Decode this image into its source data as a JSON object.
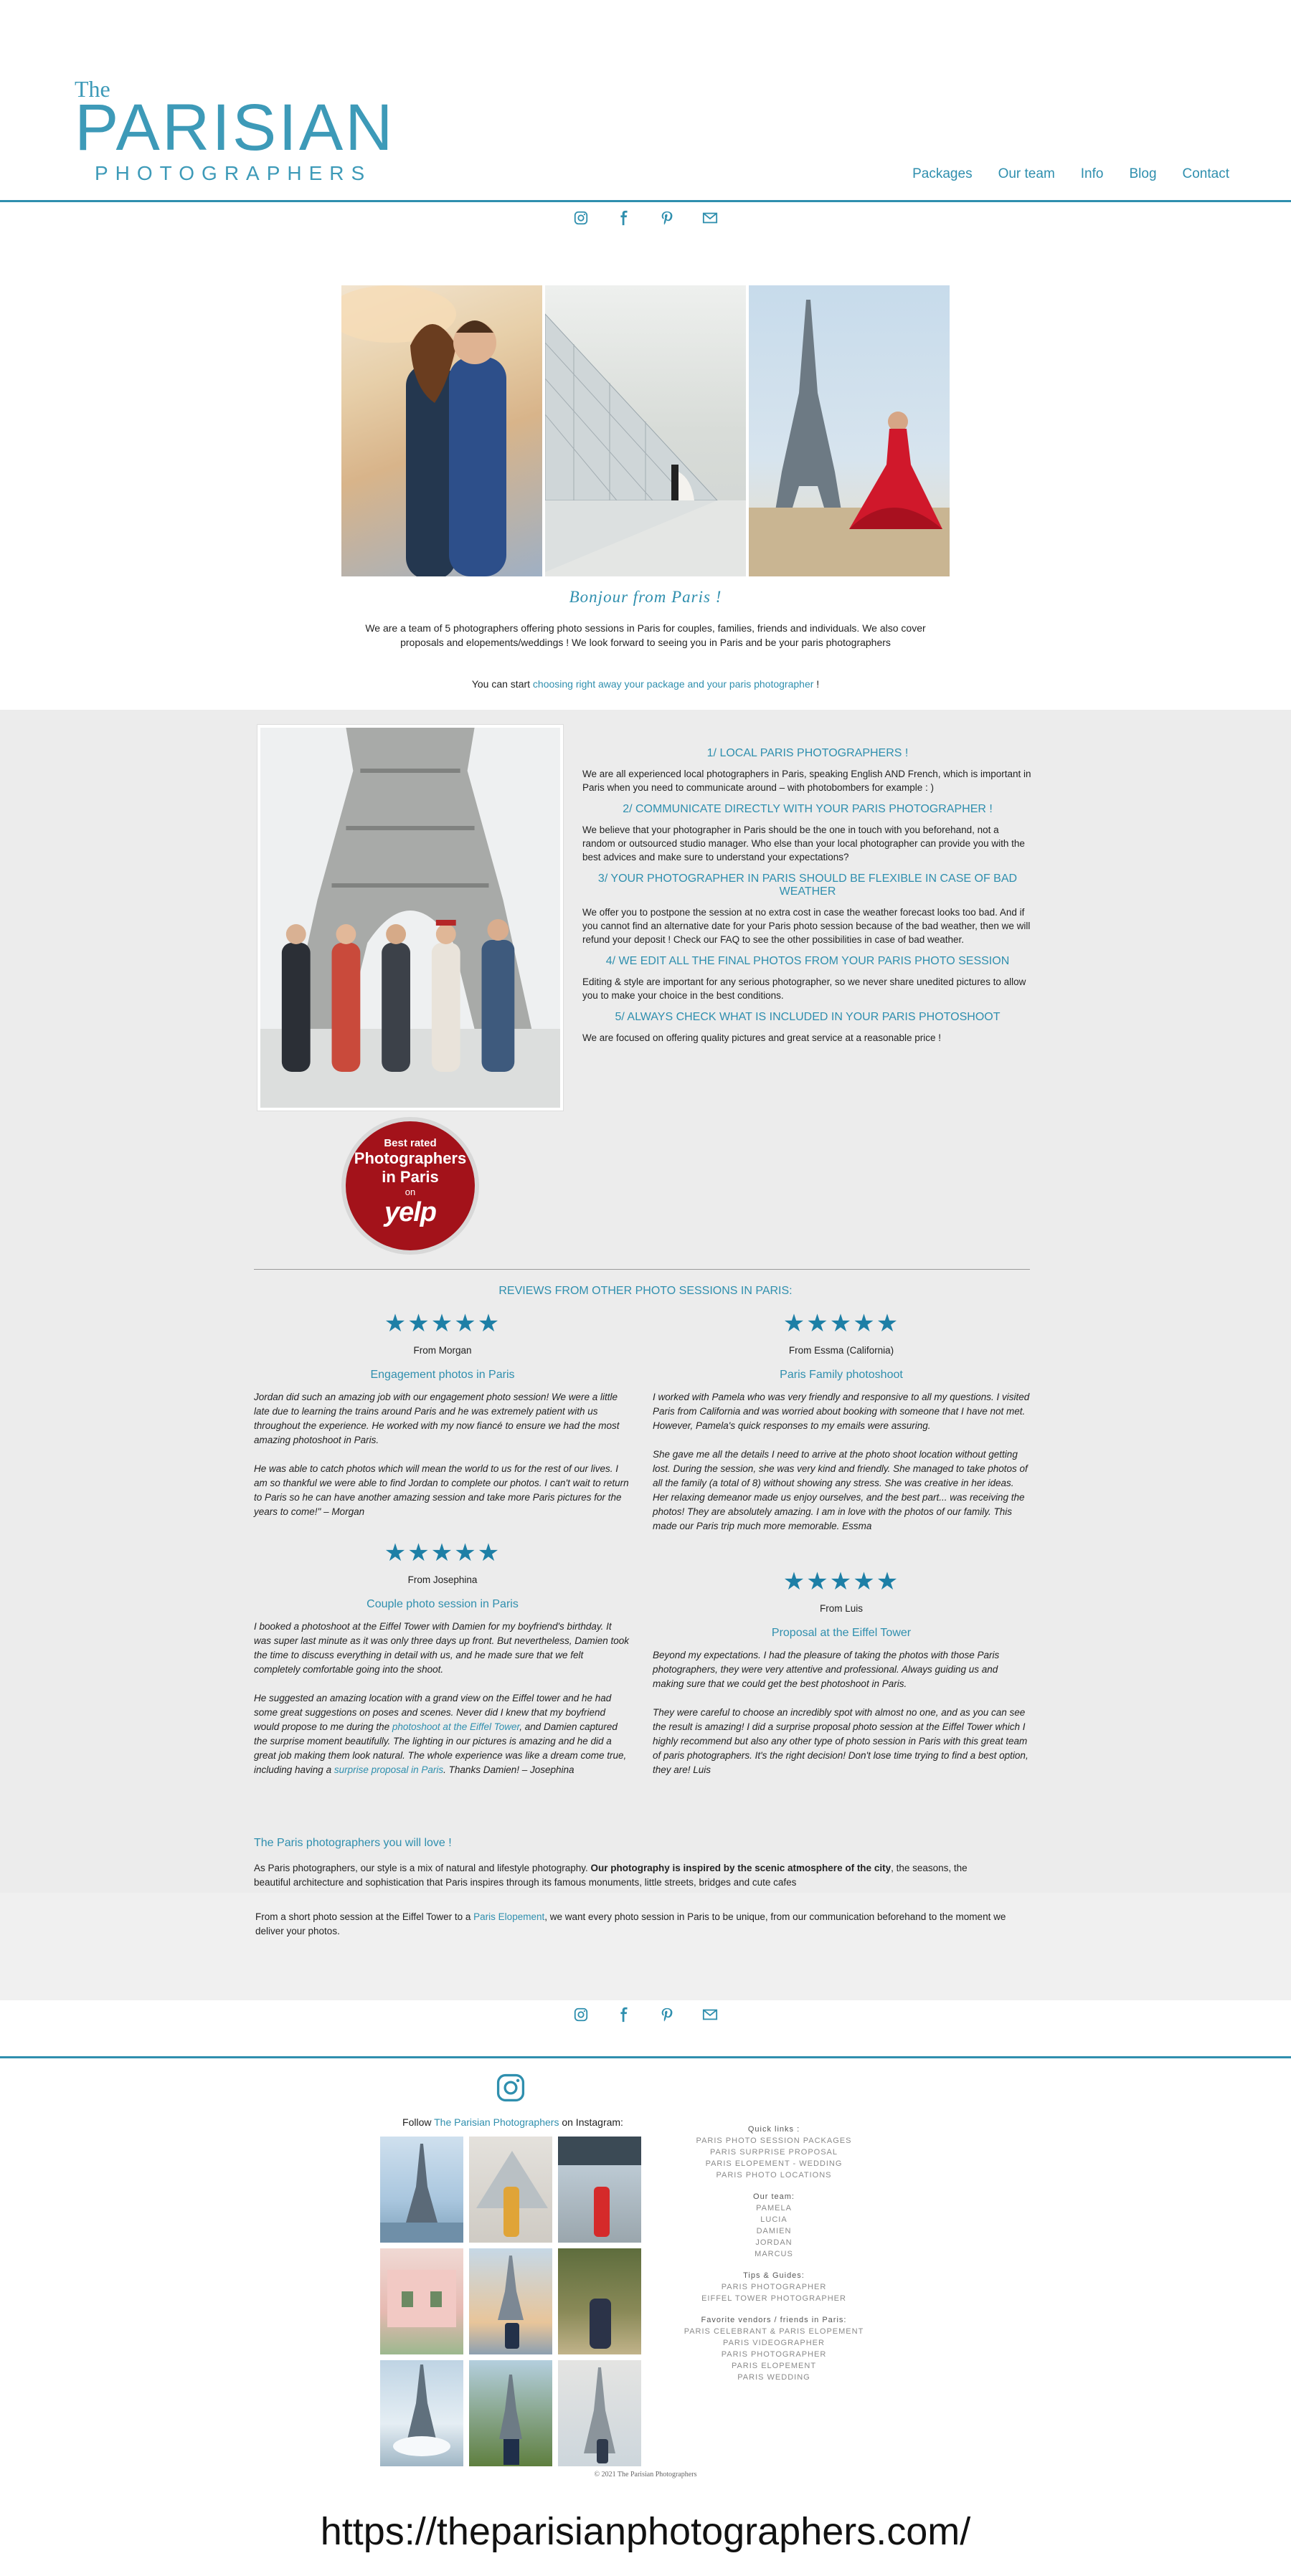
{
  "logo": {
    "line1": "The",
    "line2": "PARISIAN",
    "line3": "PHOTOGRAPHERS"
  },
  "nav": [
    "Packages",
    "Our team",
    "Info",
    "Blog",
    "Contact"
  ],
  "social_icons": [
    "instagram-icon",
    "facebook-icon",
    "pinterest-icon",
    "email-icon"
  ],
  "hero": {
    "title": "Bonjour  from  Paris !",
    "text": "We are a team of 5 photographers offering photo sessions in Paris for couples, families, friends and individuals. We also cover proposals and elopements/weddings ! We look forward to seeing you in Paris and be your paris photographers",
    "start_prefix": "You can start ",
    "start_link": "choosing right away your package and your paris photographer",
    "start_suffix": " !"
  },
  "yelp": {
    "line1": "Best rated",
    "line2": "Photographers",
    "line3": "in Paris",
    "line4": "on",
    "line5": "yelp"
  },
  "reasons": [
    {
      "heading": "1/ LOCAL PARIS PHOTOGRAPHERS !",
      "text": "We are all experienced local photographers in Paris, speaking English AND French, which is important in Paris when you need to communicate around – with photobombers for example : )"
    },
    {
      "heading": "2/ COMMUNICATE DIRECTLY WITH YOUR PARIS PHOTOGRAPHER !",
      "text": "We believe that your photographer in Paris should be the one in touch with you beforehand, not a random or outsourced studio manager. Who else than your local photographer can provide you with the best advices and make sure to understand your expectations?"
    },
    {
      "heading": "3/ YOUR PHOTOGRAPHER IN PARIS SHOULD BE FLEXIBLE IN CASE OF BAD WEATHER",
      "text": "We offer you to postpone the session at no extra cost in case the weather forecast looks too bad. And if you cannot find an alternative date for your Paris photo session because of the bad weather, then we will refund your deposit ! Check our FAQ to see the other possibilities in case of bad weather."
    },
    {
      "heading": "4/ WE EDIT ALL THE FINAL PHOTOS FROM YOUR PARIS PHOTO SESSION",
      "text": "Editing & style are important for any serious photographer, so we never share unedited pictures to allow you to make your choice in the best conditions."
    },
    {
      "heading": "5/ ALWAYS CHECK WHAT IS INCLUDED IN YOUR PARIS PHOTOSHOOT",
      "text": "We are focused on offering quality pictures and great service at a reasonable price !"
    }
  ],
  "reviews_title": "REVIEWS FROM OTHER PHOTO SESSIONS IN PARIS:",
  "stars": "★★★★★",
  "rating": 5,
  "reviews": [
    {
      "from": "From Morgan",
      "title": "Engagement photos in Paris",
      "p1": "Jordan did such an amazing job with our engagement photo session! We were a little late due to learning the trains around Paris and he was extremely patient with us throughout the experience. He worked with my now fiancé to ensure we had the most amazing photoshoot in Paris.",
      "p2": "He was able to catch photos which will mean the world to us for the rest of our lives. I am so thankful we were able to find Jordan to complete our photos. I can't wait to return to Paris so he can have another amazing session and take more Paris pictures for the years to come!\" – Morgan"
    },
    {
      "from": "From Essma (California)",
      "title": "Paris Family photoshoot",
      "p1": "I worked with Pamela who was very friendly and responsive to all my questions. I visited Paris from California and was worried about booking with someone that I have not met. However, Pamela's quick responses to my emails were assuring.",
      "p2": "She gave me all the details I need to arrive at the photo shoot location without getting lost. During the session, she was very kind and friendly. She managed to take photos of all the family (a total of 8) without showing any stress. She was creative in her ideas. Her relaxing demeanor made us enjoy ourselves, and the best part... was receiving the photos! They are absolutely amazing. I am in love with the photos of our family. This made our Paris trip much more memorable. Essma"
    },
    {
      "from": "From Josephina",
      "title": "Couple photo session in Paris",
      "p1": "I booked a photoshoot at the Eiffel Tower with Damien for my boyfriend's birthday. It was super last minute as it was only three days up front. But nevertheless, Damien took the time to discuss everything in detail with us, and he made sure that we felt completely comfortable going into the shoot.",
      "p2a": "He suggested an amazing location with a grand view on the Eiffel tower and he had some great suggestions on poses and scenes. Never did I knew that my boyfriend would propose to me during the ",
      "link1": "photoshoot at the Eiffel Tower",
      "p2b": ", and Damien captured the surprise moment beautifully. The lighting in our pictures is amazing and he did a great job making them look natural. The whole experience was like a dream come true, including having a ",
      "link2": "surprise proposal in Paris",
      "p2c": ". Thanks Damien! – Josephina"
    },
    {
      "from": "From Luis",
      "title": "Proposal at the Eiffel Tower",
      "p1": "Beyond my expectations. I had the pleasure of taking the photos with those Paris photographers, they were very attentive and professional. Always guiding us and making sure that we could get the best photoshoot in Paris.",
      "p2": "They were careful to choose an incredibly spot with almost no one, and as you can see the result is amazing! I did a surprise proposal photo session at the Eiffel Tower which I highly recommend but also any other type of photo session in Paris with this great team of paris photographers. It's the right decision! Don't lose time trying to find a best option, they are! Luis"
    }
  ],
  "intro": {
    "heading": "The Paris photographers you will love !",
    "p1a": "As Paris photographers, our style is a mix of natural and lifestyle photography. ",
    "p1b": "Our photography is inspired by the scenic atmosphere of the city",
    "p1c": ", the seasons, the beautiful architecture and sophistication that Paris inspires through its famous monuments, little streets, bridges and cute cafes",
    "p2a": "From a short photo session at the Eiffel Tower to a ",
    "p2link": "Paris Elopement",
    "p2b": ", we want every photo session in Paris to be unique, from our communication beforehand to the moment we deliver your photos."
  },
  "footer": {
    "follow_prefix": "Follow ",
    "follow_link": "The Parisian Photographers",
    "follow_suffix": " on Instagram:",
    "quick_links_head": "Quick links :",
    "quick_links": [
      "PARIS PHOTO SESSION PACKAGES",
      "PARIS SURPRISE PROPOSAL",
      "PARIS ELOPEMENT - WEDDING",
      "PARIS PHOTO LOCATIONS"
    ],
    "team_head": "Our team:",
    "team": [
      "PAMELA",
      "LUCIA",
      "DAMIEN",
      "JORDAN",
      "MARCUS"
    ],
    "tips_head": "Tips & Guides:",
    "tips": [
      "PARIS PHOTOGRAPHER",
      "EIFFEL TOWER PHOTOGRAPHER"
    ],
    "vendors_head": "Favorite vendors / friends in Paris:",
    "vendors": [
      "PARIS CELEBRANT & PARIS ELOPEMENT",
      "PARIS VIDEOGRAPHER",
      "PARIS PHOTOGRAPHER",
      "PARIS ELOPEMENT",
      "PARIS WEDDING"
    ],
    "copyright": "© 2021 The Parisian Photographers"
  },
  "url": "https://theparisianphotographers.com/"
}
